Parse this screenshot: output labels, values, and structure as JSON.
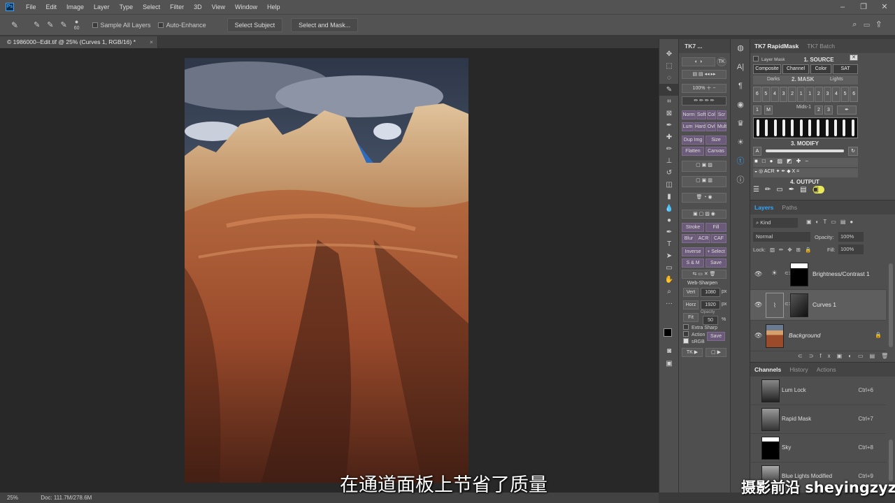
{
  "menubar": {
    "logo": "Ps",
    "items": [
      "File",
      "Edit",
      "Image",
      "Layer",
      "Type",
      "Select",
      "Filter",
      "3D",
      "View",
      "Window",
      "Help"
    ],
    "window_controls": [
      "–",
      "❐",
      "✕"
    ]
  },
  "options": {
    "brush_size": "60",
    "sample_all_layers": "Sample All Layers",
    "auto_enhance": "Auto-Enhance",
    "select_subject": "Select Subject",
    "select_and_mask": "Select and Mask..."
  },
  "document": {
    "tab_title": "© 1986000--Edit.tif @ 25% (Curves 1, RGB/16) *",
    "close": "×",
    "zoom": "25%",
    "doc_size": "Doc: 111.7M/278.6M"
  },
  "tk_panel": {
    "title": "TK7 ...",
    "buttons": [
      "Norm",
      "Soft",
      "Col",
      "Scr",
      "Lum",
      "Hard",
      "Ovl",
      "Mult",
      "Dup Img",
      "Size",
      "Flatten",
      "Canvas",
      "Stroke",
      "Fill",
      "Blur",
      "ACR",
      "CAF",
      "Inverse",
      "+ Select",
      "S & M",
      "Save"
    ],
    "percent": "100%",
    "web_sharpen": "Web-Sharpen",
    "vert_label": "Vert",
    "vert_value": "1080",
    "horz_label": "Horz",
    "horz_value": "1920",
    "px": "px",
    "fit": "Fit",
    "opacity_label": "Opacity",
    "opacity_value": "50",
    "pct": "%",
    "extra_sharp": "Extra Sharp",
    "action": "Action",
    "srgb": "sRGB",
    "save": "Save",
    "tk_button": "TK ▶"
  },
  "rapidmask": {
    "tabs": [
      "TK7 RapidMask",
      "TK7 Batch"
    ],
    "layer_mask": "Layer Mask",
    "source_title": "1. SOURCE",
    "source_buttons": [
      "Composite",
      "Channel",
      "Color",
      "SAT"
    ],
    "mask_title": "2. MASK",
    "darks": "Darks",
    "lights": "Lights",
    "mids": "Mids-1",
    "dark_nums": [
      "6",
      "5",
      "4",
      "3",
      "2",
      "1"
    ],
    "light_nums": [
      "1",
      "2",
      "3",
      "4",
      "5",
      "6"
    ],
    "mid_nums": [
      "1",
      "M",
      "2",
      "3"
    ],
    "modify_title": "3. MODIFY",
    "a_label": "A",
    "acr": "ACR",
    "x": "X",
    "output_title": "4. OUTPUT"
  },
  "layers": {
    "tabs": [
      "Layers",
      "Paths"
    ],
    "kind": "Kind",
    "blend_mode": "Normal",
    "opacity_label": "Opacity:",
    "opacity_value": "100%",
    "lock_label": "Lock:",
    "fill_label": "Fill:",
    "fill_value": "100%",
    "rows": [
      {
        "name": "Brightness/Contrast 1"
      },
      {
        "name": "Curves 1"
      },
      {
        "name": "Background"
      }
    ]
  },
  "channels": {
    "tabs": [
      "Channels",
      "History",
      "Actions"
    ],
    "rows": [
      {
        "name": "Lum Lock",
        "key": "Ctrl+6"
      },
      {
        "name": "Rapid Mask",
        "key": "Ctrl+7"
      },
      {
        "name": "Sky",
        "key": "Ctrl+8"
      },
      {
        "name": "Blue Lights Modified",
        "key": "Ctrl+9"
      }
    ]
  },
  "subtitle": "在通道面板上节省了质量",
  "watermark": "摄影前沿 sheyingzyz.com",
  "colors": {
    "ui_bg": "#535353",
    "panel_bg": "#4f4f4f",
    "canvas_bg": "#282828",
    "accent": "#31a8ff"
  }
}
